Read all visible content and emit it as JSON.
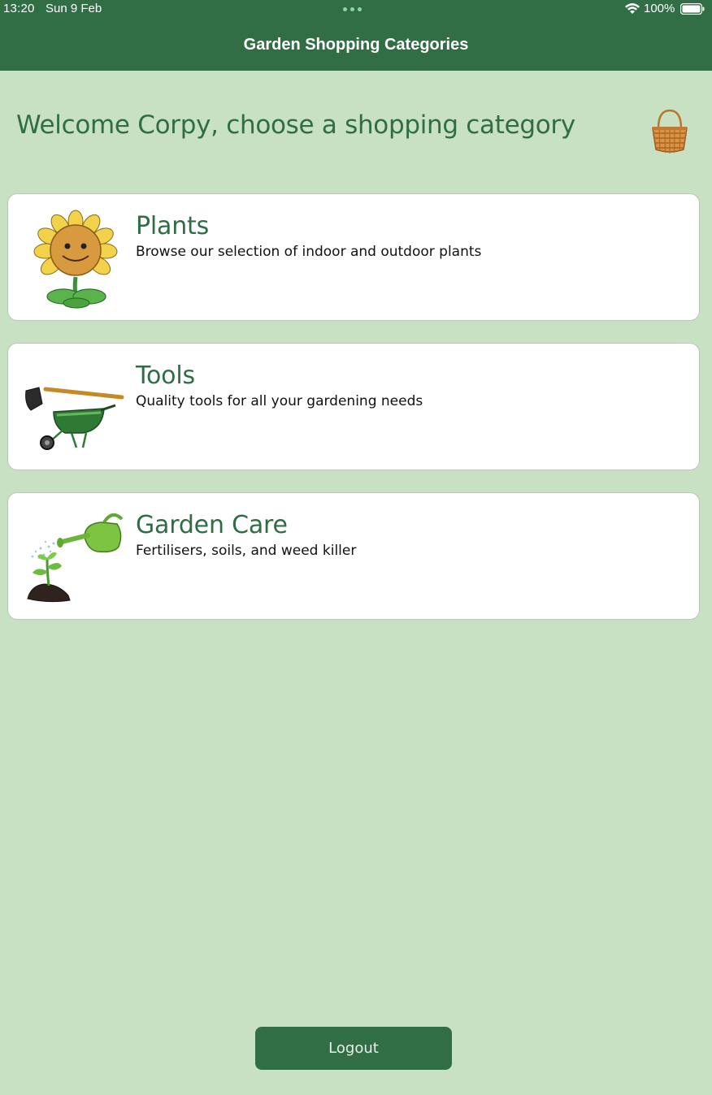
{
  "status_bar": {
    "time": "13:20",
    "date": "Sun 9 Feb",
    "battery": "100%",
    "icons": [
      "wifi-icon",
      "battery-icon"
    ]
  },
  "nav": {
    "title": "Garden Shopping Categories"
  },
  "welcome": {
    "text": "Welcome Corpy, choose a shopping category",
    "basket_icon": "basket-icon"
  },
  "categories": [
    {
      "title": "Plants",
      "description": "Browse our selection of indoor and outdoor plants",
      "image": "sunflower-icon"
    },
    {
      "title": "Tools",
      "description": "Quality tools for all your gardening needs",
      "image": "wheelbarrow-hoe-icon"
    },
    {
      "title": "Garden Care",
      "description": "Fertilisers, soils, and weed killer",
      "image": "watering-can-icon"
    }
  ],
  "logout": {
    "label": "Logout"
  },
  "colors": {
    "primary": "#316e45",
    "background": "#c8e1c3",
    "accent_text": "#2f6e45",
    "card_background": "#ffffff"
  }
}
